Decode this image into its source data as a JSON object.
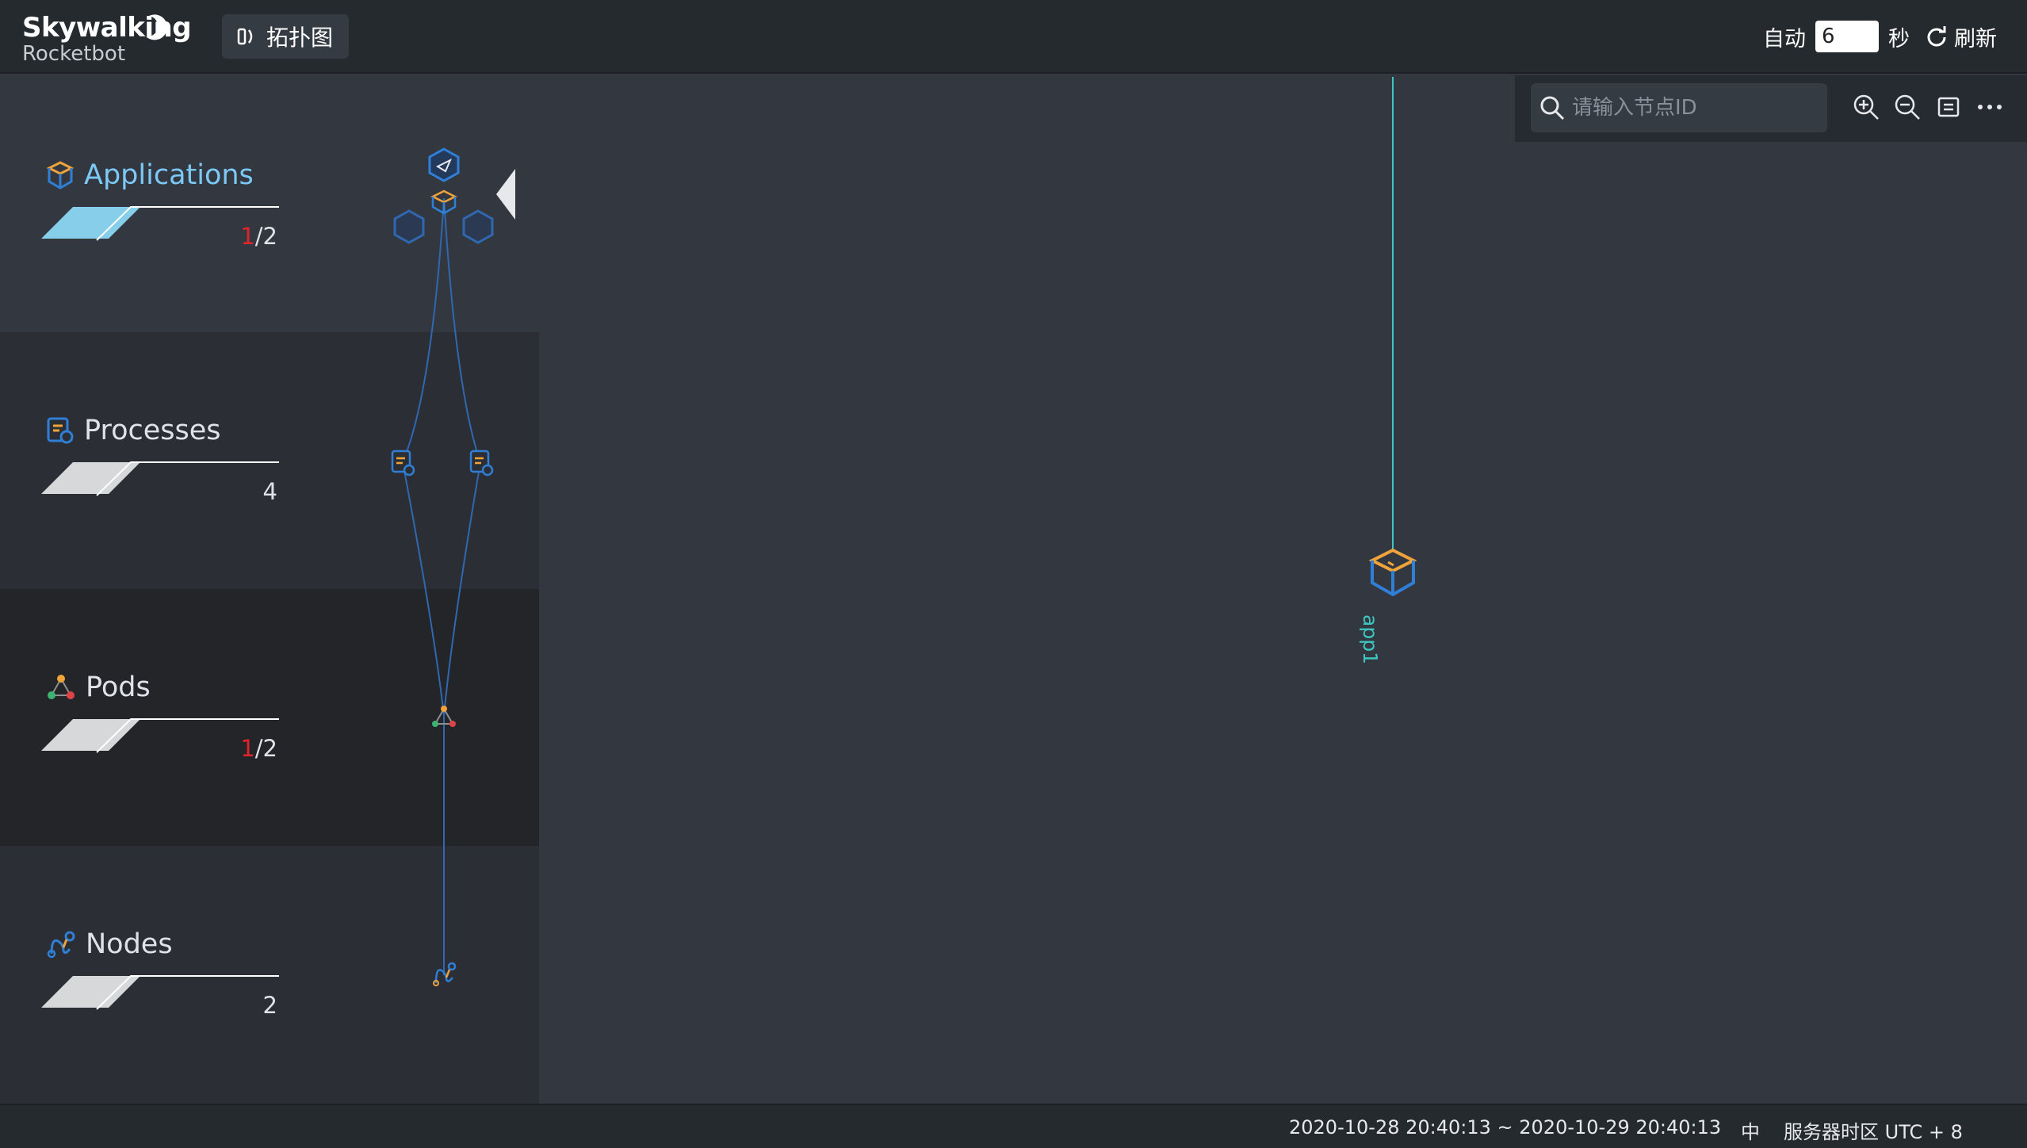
{
  "brand": {
    "title": "Skywalking",
    "subtitle": "Rocketbot"
  },
  "nav": {
    "topology_tab": "拓扑图"
  },
  "header": {
    "auto_label": "自动",
    "interval_value": "6",
    "interval_unit": "秒",
    "refresh_label": "刷新"
  },
  "layers": [
    {
      "name": "Applications",
      "highlight": "1",
      "total": "/2",
      "count": "",
      "icon": "cube-icon",
      "active": true
    },
    {
      "name": "Processes",
      "highlight": "",
      "total": "",
      "count": "4",
      "icon": "process-icon",
      "active": false
    },
    {
      "name": "Pods",
      "highlight": "1",
      "total": "/2",
      "count": "",
      "icon": "pod-icon",
      "active": false
    },
    {
      "name": "Nodes",
      "highlight": "",
      "total": "",
      "count": "2",
      "icon": "node-icon",
      "active": false
    }
  ],
  "toolbar": {
    "search_placeholder": "请输入节点ID",
    "icons": [
      "zoom-in-icon",
      "zoom-out-icon",
      "fit-view-icon",
      "more-icon"
    ]
  },
  "canvas": {
    "node_label": "app1"
  },
  "footer": {
    "time_range": "2020-10-28 20:40:13 ~ 2020-10-29 20:40:13",
    "language": "中",
    "timezone": "服务器时区 UTC + 8"
  },
  "colors": {
    "accent_blue": "#7cc9f5",
    "node_orange": "#f0a33a",
    "node_blue": "#2f7fd6",
    "teal": "#3cc7c0",
    "highlight_red": "#e0242a"
  }
}
